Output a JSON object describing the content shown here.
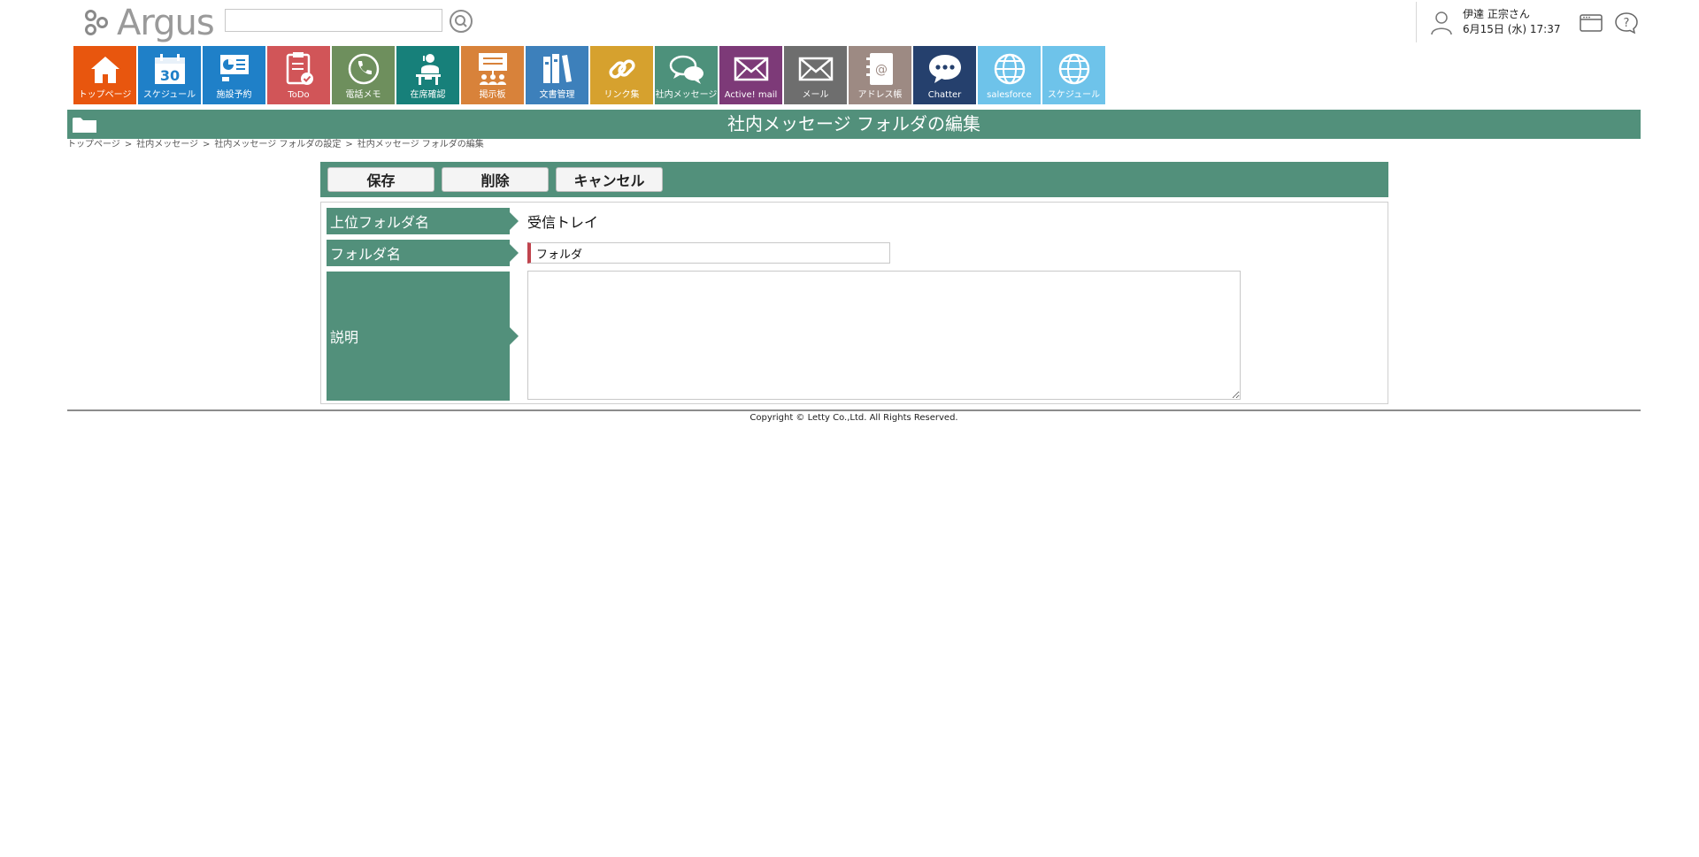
{
  "header": {
    "logo_text": "Argus",
    "search": {
      "value": "",
      "placeholder": ""
    },
    "user": {
      "name": "伊達 正宗さん",
      "datetime": "6月15日 (水) 17:37"
    },
    "icons": [
      "search-icon",
      "user-icon",
      "window-icon",
      "help-icon"
    ]
  },
  "nav": {
    "tiles": [
      {
        "label": "トップページ",
        "color": "#e8560e",
        "icon": "home-icon"
      },
      {
        "label": "スケジュール",
        "color": "#1f80c8",
        "icon": "calendar-icon",
        "badge": "30"
      },
      {
        "label": "施設予約",
        "color": "#1f80c8",
        "icon": "facility-icon"
      },
      {
        "label": "ToDo",
        "color": "#d15558",
        "icon": "todo-icon"
      },
      {
        "label": "電話メモ",
        "color": "#6e8f5d",
        "icon": "phone-icon"
      },
      {
        "label": "在席確認",
        "color": "#17807a",
        "icon": "presence-icon"
      },
      {
        "label": "掲示板",
        "color": "#d8823a",
        "icon": "board-icon"
      },
      {
        "label": "文書管理",
        "color": "#3d80bb",
        "icon": "document-icon"
      },
      {
        "label": "リンク集",
        "color": "#d6a12e",
        "icon": "link-icon"
      },
      {
        "label": "社内メッセージ",
        "color": "#4d917b",
        "icon": "message-icon"
      },
      {
        "label": "Active! mail",
        "color": "#7d3a78",
        "icon": "mail-icon"
      },
      {
        "label": "メール",
        "color": "#6e6e6e",
        "icon": "mail-icon"
      },
      {
        "label": "アドレス帳",
        "color": "#9d8a83",
        "icon": "address-book-icon"
      },
      {
        "label": "Chatter",
        "color": "#25406d",
        "icon": "chat-icon"
      },
      {
        "label": "salesforce",
        "color": "#6ec3ea",
        "icon": "globe-icon"
      },
      {
        "label": "スケジュール",
        "color": "#6ec3ea",
        "icon": "globe-icon"
      }
    ]
  },
  "page": {
    "title": "社内メッセージ フォルダの編集",
    "title_bar_color": "#52907b",
    "breadcrumb": [
      "トップページ",
      "社内メッセージ",
      "社内メッセージ フォルダの設定",
      "社内メッセージ フォルダの編集"
    ],
    "breadcrumb_sep": ">"
  },
  "toolbar": {
    "save_label": "保存",
    "delete_label": "削除",
    "cancel_label": "キャンセル"
  },
  "form": {
    "parent_folder_label": "上位フォルダ名",
    "parent_folder_value": "受信トレイ",
    "folder_name_label": "フォルダ名",
    "folder_name_value": "フォルダ",
    "description_label": "説明",
    "description_value": ""
  },
  "footer": {
    "copyright": "Copyright © Letty Co.,Ltd. All Rights Reserved."
  }
}
